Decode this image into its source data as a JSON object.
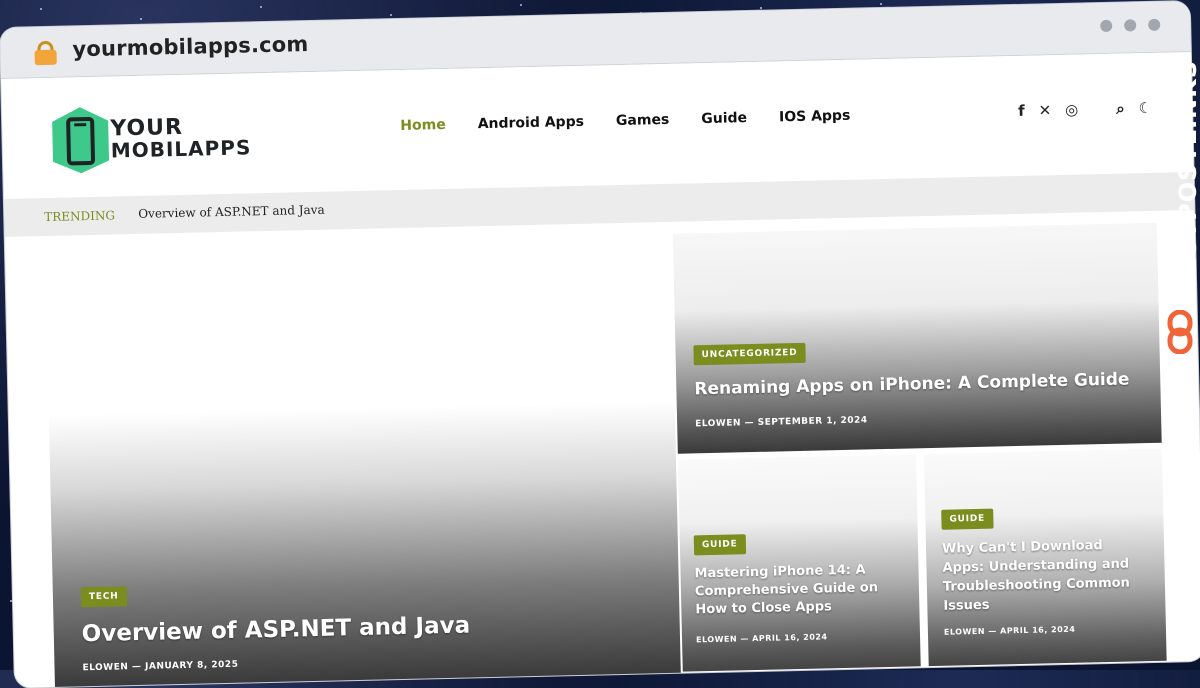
{
  "browser": {
    "url": "yourmobilapps.com"
  },
  "logo": {
    "line1": "YOUR",
    "line2": "MOBILAPPS"
  },
  "nav": [
    {
      "label": "Home",
      "active": true
    },
    {
      "label": "Android Apps"
    },
    {
      "label": "Games"
    },
    {
      "label": "Guide"
    },
    {
      "label": "IOS Apps"
    }
  ],
  "social_icons": [
    "facebook-icon",
    "x-icon",
    "instagram-icon",
    "search-icon",
    "moon-icon"
  ],
  "trending": {
    "label": "TRENDING",
    "text": "Overview of ASP.NET and Java"
  },
  "posts": {
    "featured": {
      "category": "TECH",
      "title": "Overview of ASP.NET and Java",
      "author": "ELOWEN",
      "date": "JANUARY 8, 2025"
    },
    "top_right": {
      "category": "UNCATEGORIZED",
      "title": "Renaming Apps on iPhone: A Complete Guide",
      "author": "ELOWEN",
      "date": "SEPTEMBER 1, 2024"
    },
    "bottom_left": {
      "category": "GUIDE",
      "title": "Mastering iPhone 14: A Comprehensive Guide on How to Close Apps",
      "author": "ELOWEN",
      "date": "APRIL 16, 2024"
    },
    "bottom_right": {
      "category": "GUIDE",
      "title": "Why Can't I Download Apps: Understanding and Troubleshooting Common Issues",
      "author": "ELOWEN",
      "date": "APRIL 16, 2024"
    }
  },
  "watermark": {
    "text": "GUESTPOSTLINKS"
  },
  "colors": {
    "accent": "#7a8d1e",
    "logo_green": "#3ec98a",
    "watermark_orange": "#f0643a"
  }
}
